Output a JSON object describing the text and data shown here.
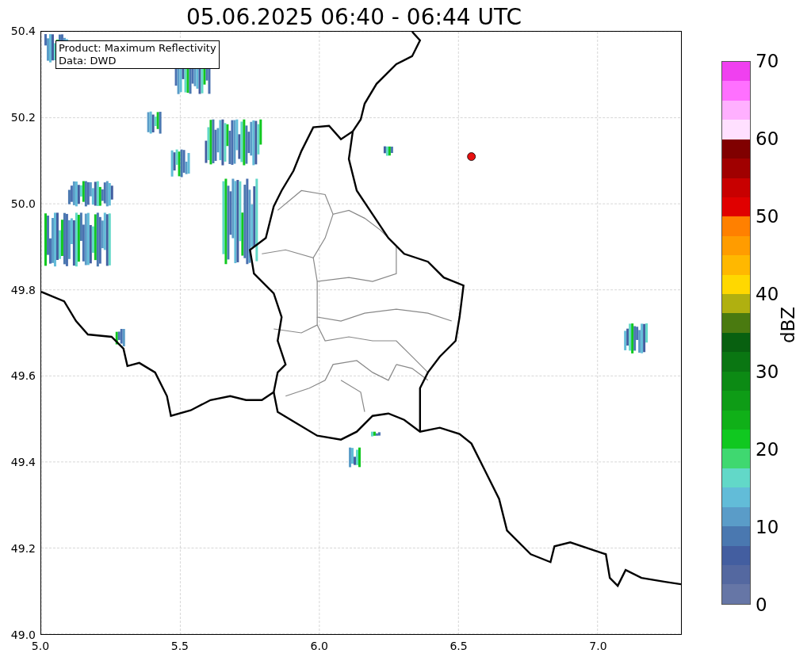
{
  "title": "05.06.2025 06:40 - 06:44 UTC",
  "map": {
    "info_box": [
      "Product: Maximum Reflectivity",
      "Data: DWD"
    ],
    "yticks": [
      "50.4",
      "50.2",
      "50.0",
      "49.8",
      "49.6",
      "49.4",
      "49.2",
      "49.0"
    ],
    "xticks": [
      "5.0",
      "5.5",
      "6.0",
      "6.5",
      "7.0"
    ]
  },
  "colorbar": {
    "label": "dBZ",
    "ticks": [
      "70",
      "60",
      "50",
      "40",
      "30",
      "20",
      "10",
      "0"
    ]
  }
}
